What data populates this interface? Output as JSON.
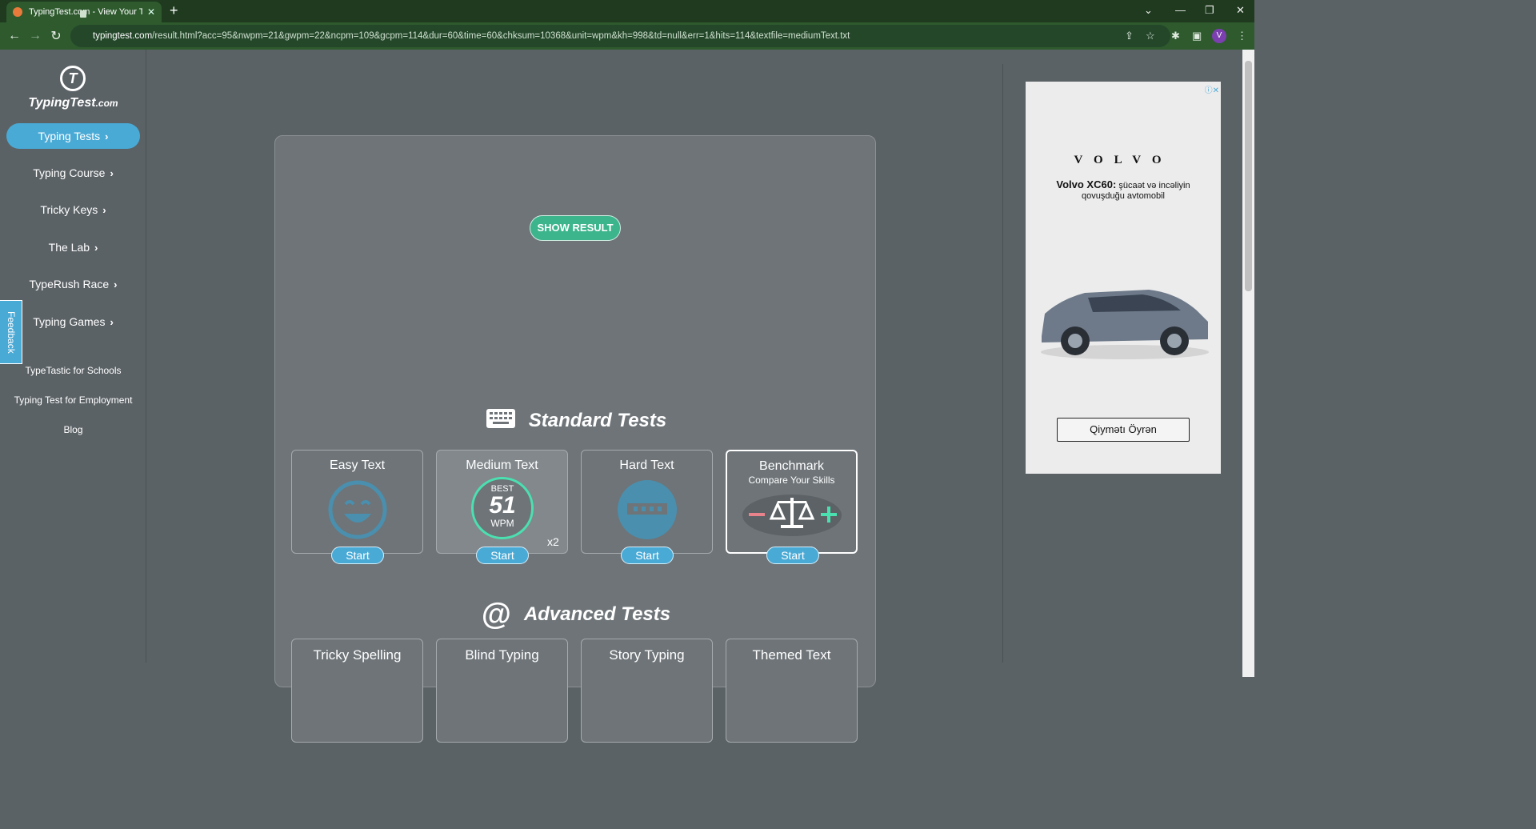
{
  "browser": {
    "tab_title": "TypingTest.com - View Your Typin",
    "url_host": "typingtest.com",
    "url_path": "/result.html?acc=95&nwpm=21&gwpm=22&ncpm=109&gcpm=114&dur=60&time=60&chksum=10368&unit=wpm&kh=998&td=null&err=1&hits=114&textfile=mediumText.txt",
    "profile_initial": "V"
  },
  "sidebar": {
    "logo_mark": "T",
    "logo_main": "TypingTest",
    "logo_suffix": ".com",
    "items": [
      {
        "label": "Typing Tests"
      },
      {
        "label": "Typing Course"
      },
      {
        "label": "Tricky Keys"
      },
      {
        "label": "The Lab"
      },
      {
        "label": "TypeRush Race"
      },
      {
        "label": "Typing Games"
      }
    ],
    "links": [
      {
        "label": "TypeTastic for Schools"
      },
      {
        "label": "Typing Test for Employment"
      },
      {
        "label": "Blog"
      }
    ],
    "feedback": "Feedback"
  },
  "main": {
    "show_result": "SHOW RESULT",
    "standard_title": "Standard Tests",
    "advanced_title": "Advanced Tests",
    "standard_tests": [
      {
        "title": "Easy Text",
        "start": "Start"
      },
      {
        "title": "Medium Text",
        "start": "Start",
        "best_label": "BEST",
        "best_value": "51",
        "best_unit": "WPM",
        "count": "x2"
      },
      {
        "title": "Hard Text",
        "start": "Start"
      },
      {
        "title": "Benchmark",
        "subtitle": "Compare Your Skills",
        "start": "Start"
      }
    ],
    "advanced_tests": [
      {
        "title": "Tricky Spelling"
      },
      {
        "title": "Blind Typing"
      },
      {
        "title": "Story Typing"
      },
      {
        "title": "Themed Text"
      }
    ]
  },
  "ad": {
    "brand": "VOLVO",
    "headline_bold": "Volvo XC60:",
    "headline_rest": " şücaət və incəliyin qovuşduğu avtomobil",
    "cta": "Qiymətı Öyrən"
  },
  "colors": {
    "accent": "#4aaad6",
    "result_button": "#3cb48c",
    "best_ring": "#4be0b0"
  }
}
